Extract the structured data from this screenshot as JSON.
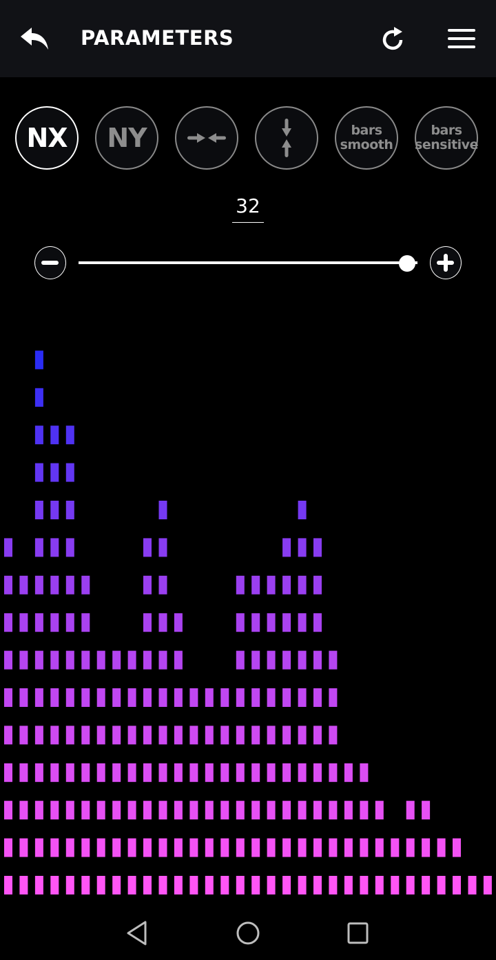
{
  "header": {
    "title": "PARAMETERS",
    "back_icon": "reply-arrow-icon",
    "refresh_icon": "refresh-icon",
    "menu_icon": "hamburger-menu-icon"
  },
  "modes": [
    {
      "id": "nx",
      "label": "NX",
      "type": "text-big",
      "active": true
    },
    {
      "id": "ny",
      "label": "NY",
      "type": "text-big",
      "active": false
    },
    {
      "id": "horizontal-center",
      "icon": "arrows-converge-horizontal-icon",
      "type": "icon",
      "active": false
    },
    {
      "id": "vertical-center",
      "icon": "arrows-converge-vertical-icon",
      "type": "icon",
      "active": false
    },
    {
      "id": "bars-smooth",
      "label_line1": "bars",
      "label_line2": "smooth",
      "type": "text-small",
      "active": false
    },
    {
      "id": "bars-sensitive",
      "label_line1": "bars",
      "label_line2": "sensitive",
      "type": "text-small",
      "active": false
    }
  ],
  "parameter": {
    "value": "32",
    "slider_fraction": 0.97
  },
  "controls": {
    "minus_icon": "minus-circle-icon",
    "plus_icon": "plus-circle-icon"
  },
  "visualizer": {
    "columns": 32,
    "rows": 15,
    "color_top": "#2a2cf5",
    "color_mid": "#a040f0",
    "color_bottom": "#ff55f5",
    "levels": [
      10,
      9,
      15,
      13,
      13,
      9,
      7,
      7,
      7,
      10,
      11,
      8,
      6,
      6,
      6,
      9,
      9,
      9,
      10,
      11,
      10,
      7,
      4,
      4,
      3,
      2,
      3,
      3,
      2,
      2,
      1,
      1
    ]
  },
  "navbar": {
    "back_icon": "nav-back-triangle-icon",
    "home_icon": "nav-home-circle-icon",
    "recents_icon": "nav-recents-square-icon"
  }
}
